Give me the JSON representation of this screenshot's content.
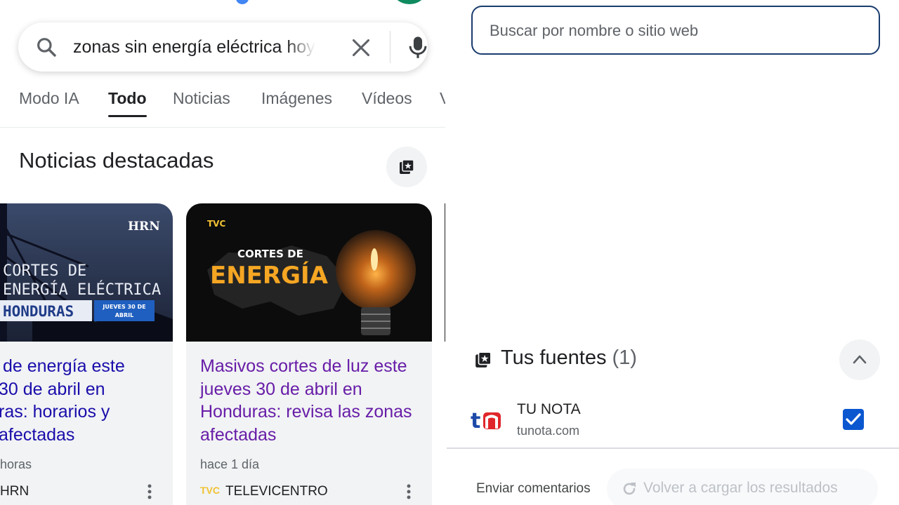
{
  "search": {
    "query": "zonas sin energía eléctrica hoy",
    "clear_icon": "close-icon",
    "voice_icon": "mic-icon"
  },
  "tabs": [
    {
      "label": "Modo IA",
      "active": false
    },
    {
      "label": "Todo",
      "active": true
    },
    {
      "label": "Noticias",
      "active": false
    },
    {
      "label": "Imágenes",
      "active": false
    },
    {
      "label": "Vídeos",
      "active": false
    },
    {
      "label": "V",
      "active": false
    }
  ],
  "top_news": {
    "title": "Noticias destacadas",
    "cards": [
      {
        "image_text_line1": "CORTES DE",
        "image_text_line2": "ENERGÍA ELÉCTRICA",
        "image_badge": "HONDURAS",
        "image_date": "JUEVES 30 DE ABRIL",
        "image_logo": "HRN",
        "headline": "de energía este 30 de abril en ras: horarios y afectadas",
        "headline_lines": [
          " de energía este",
          "30 de abril en",
          "ras: horarios y",
          "afectadas"
        ],
        "time": "horas",
        "source": "HRN"
      },
      {
        "image_logo": "TVC",
        "image_text_line1": "CORTES DE",
        "image_text_line2": "ENERGÍA",
        "headline": "Masivos cortes de luz este jueves 30 de abril en Honduras: revisa las zonas afectadas",
        "time": "hace 1 día",
        "source": "TELEVICENTRO",
        "source_logo": "TVC"
      }
    ]
  },
  "site_search": {
    "placeholder": "Buscar por nombre o sitio web"
  },
  "your_sources": {
    "title": "Tus fuentes",
    "count": "(1)",
    "items": [
      {
        "logo": "tn",
        "name": "TU NOTA",
        "url": "tunota.com",
        "checked": true
      }
    ]
  },
  "footer": {
    "feedback": "Enviar comentarios",
    "reload": "Volver a cargar los resultados"
  },
  "colors": {
    "link_blue": "#1a0dab",
    "visited_purple": "#681da8",
    "checkbox_blue": "#0b57d0",
    "accent_border": "#1a3c6e"
  }
}
